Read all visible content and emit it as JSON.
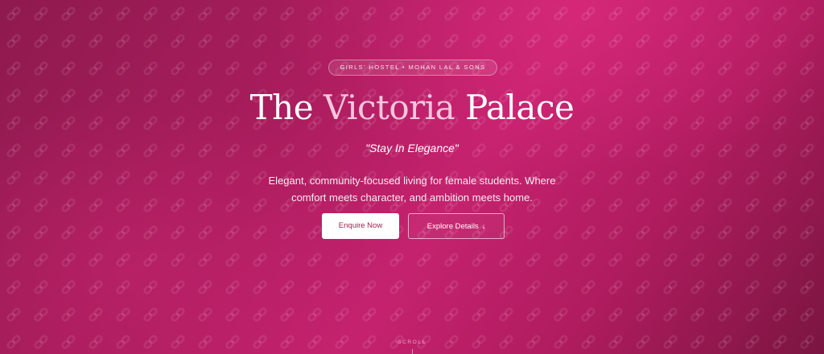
{
  "hero": {
    "badge": "GIRLS' HOSTEL • MOHAN LAL & SONS",
    "title_part1": "The",
    "title_accent": "Victoria",
    "title_part2": "Palace",
    "tagline": "\"Stay In Elegance\"",
    "description": "Elegant, community-focused living for female students. Where comfort meets character, and ambition meets home.",
    "primary_button": "Enquire Now",
    "secondary_button": "Explore Details",
    "secondary_button_icon": "↓",
    "scroll_label": "SCROLL"
  },
  "colors": {
    "background": "#b01c5f",
    "title_accent": "#f6c6dd",
    "primary_button_text": "#a3204f",
    "text": "#ffffff"
  },
  "icons": {
    "background_pattern": "link-chain-icon",
    "secondary_button": "arrow-down-icon"
  }
}
